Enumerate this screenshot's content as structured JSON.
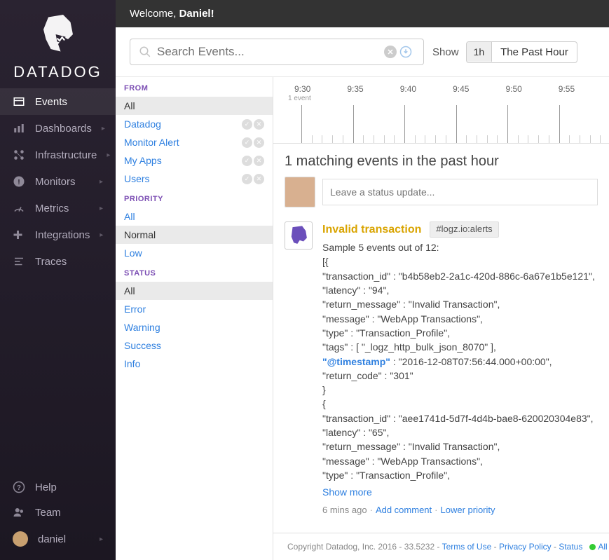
{
  "brand": "DATADOG",
  "welcome": {
    "prefix": "Welcome, ",
    "name": "Daniel!",
    "full": "Welcome, Daniel!"
  },
  "nav": {
    "items": [
      {
        "label": "Events"
      },
      {
        "label": "Dashboards"
      },
      {
        "label": "Infrastructure"
      },
      {
        "label": "Monitors"
      },
      {
        "label": "Metrics"
      },
      {
        "label": "Integrations"
      },
      {
        "label": "Traces"
      }
    ],
    "bottom": [
      {
        "label": "Help"
      },
      {
        "label": "Team"
      },
      {
        "label": "daniel"
      }
    ]
  },
  "search": {
    "placeholder": "Search Events..."
  },
  "timerange": {
    "show_label": "Show",
    "pill": "1h",
    "text": "The Past Hour"
  },
  "filters": {
    "from_heading": "FROM",
    "from": [
      {
        "label": "All",
        "selected": true,
        "actions": false
      },
      {
        "label": "Datadog",
        "selected": false,
        "actions": true
      },
      {
        "label": "Monitor Alert",
        "selected": false,
        "actions": true
      },
      {
        "label": "My Apps",
        "selected": false,
        "actions": true
      },
      {
        "label": "Users",
        "selected": false,
        "actions": true
      }
    ],
    "priority_heading": "PRIORITY",
    "priority": [
      {
        "label": "All",
        "selected": false
      },
      {
        "label": "Normal",
        "selected": true
      },
      {
        "label": "Low",
        "selected": false
      }
    ],
    "status_heading": "STATUS",
    "status": [
      {
        "label": "All",
        "selected": true
      },
      {
        "label": "Error",
        "selected": false
      },
      {
        "label": "Warning",
        "selected": false
      },
      {
        "label": "Success",
        "selected": false
      },
      {
        "label": "Info",
        "selected": false
      }
    ]
  },
  "timeline": {
    "labels": [
      "9:30",
      "9:35",
      "9:40",
      "9:45",
      "9:50",
      "9:55"
    ],
    "sublabel": "1 event"
  },
  "events_header": "1 matching events in the past hour",
  "status_placeholder": "Leave a status update...",
  "event": {
    "title": "Invalid transaction",
    "tag": "#logz.io:alerts",
    "summary": "Sample 5 events out of 12:",
    "lines": [
      "[{",
      "\"transaction_id\" : \"b4b58eb2-2a1c-420d-886c-6a67e1b5e121\",",
      "\"latency\" : \"94\",",
      "\"return_message\" : \"Invalid Transaction\",",
      "\"message\" : \"WebApp Transactions\",",
      "\"type\" : \"Transaction_Profile\",",
      "\"tags\" : [ \"_logz_http_bulk_json_8070\" ],"
    ],
    "ts_key": "\"@timestamp\"",
    "ts_rest": " : \"2016-12-08T07:56:44.000+00:00\",",
    "lines2": [
      "\"return_code\" : \"301\"",
      "}",
      "{",
      "\"transaction_id\" : \"aee1741d-5d7f-4d4b-bae8-620020304e83\",",
      "\"latency\" : \"65\",",
      "\"return_message\" : \"Invalid Transaction\",",
      "\"message\" : \"WebApp Transactions\",",
      "\"type\" : \"Transaction_Profile\","
    ],
    "show_more": "Show more",
    "meta_time": "6 mins ago",
    "meta_add": "Add comment",
    "meta_lower": "Lower priority"
  },
  "footer": {
    "copyright": "Copyright Datadog, Inc. 2016 - 33.5232 - ",
    "terms": "Terms of Use",
    "privacy": "Privacy Policy",
    "status": "Status",
    "all_sys": "All Sys"
  }
}
